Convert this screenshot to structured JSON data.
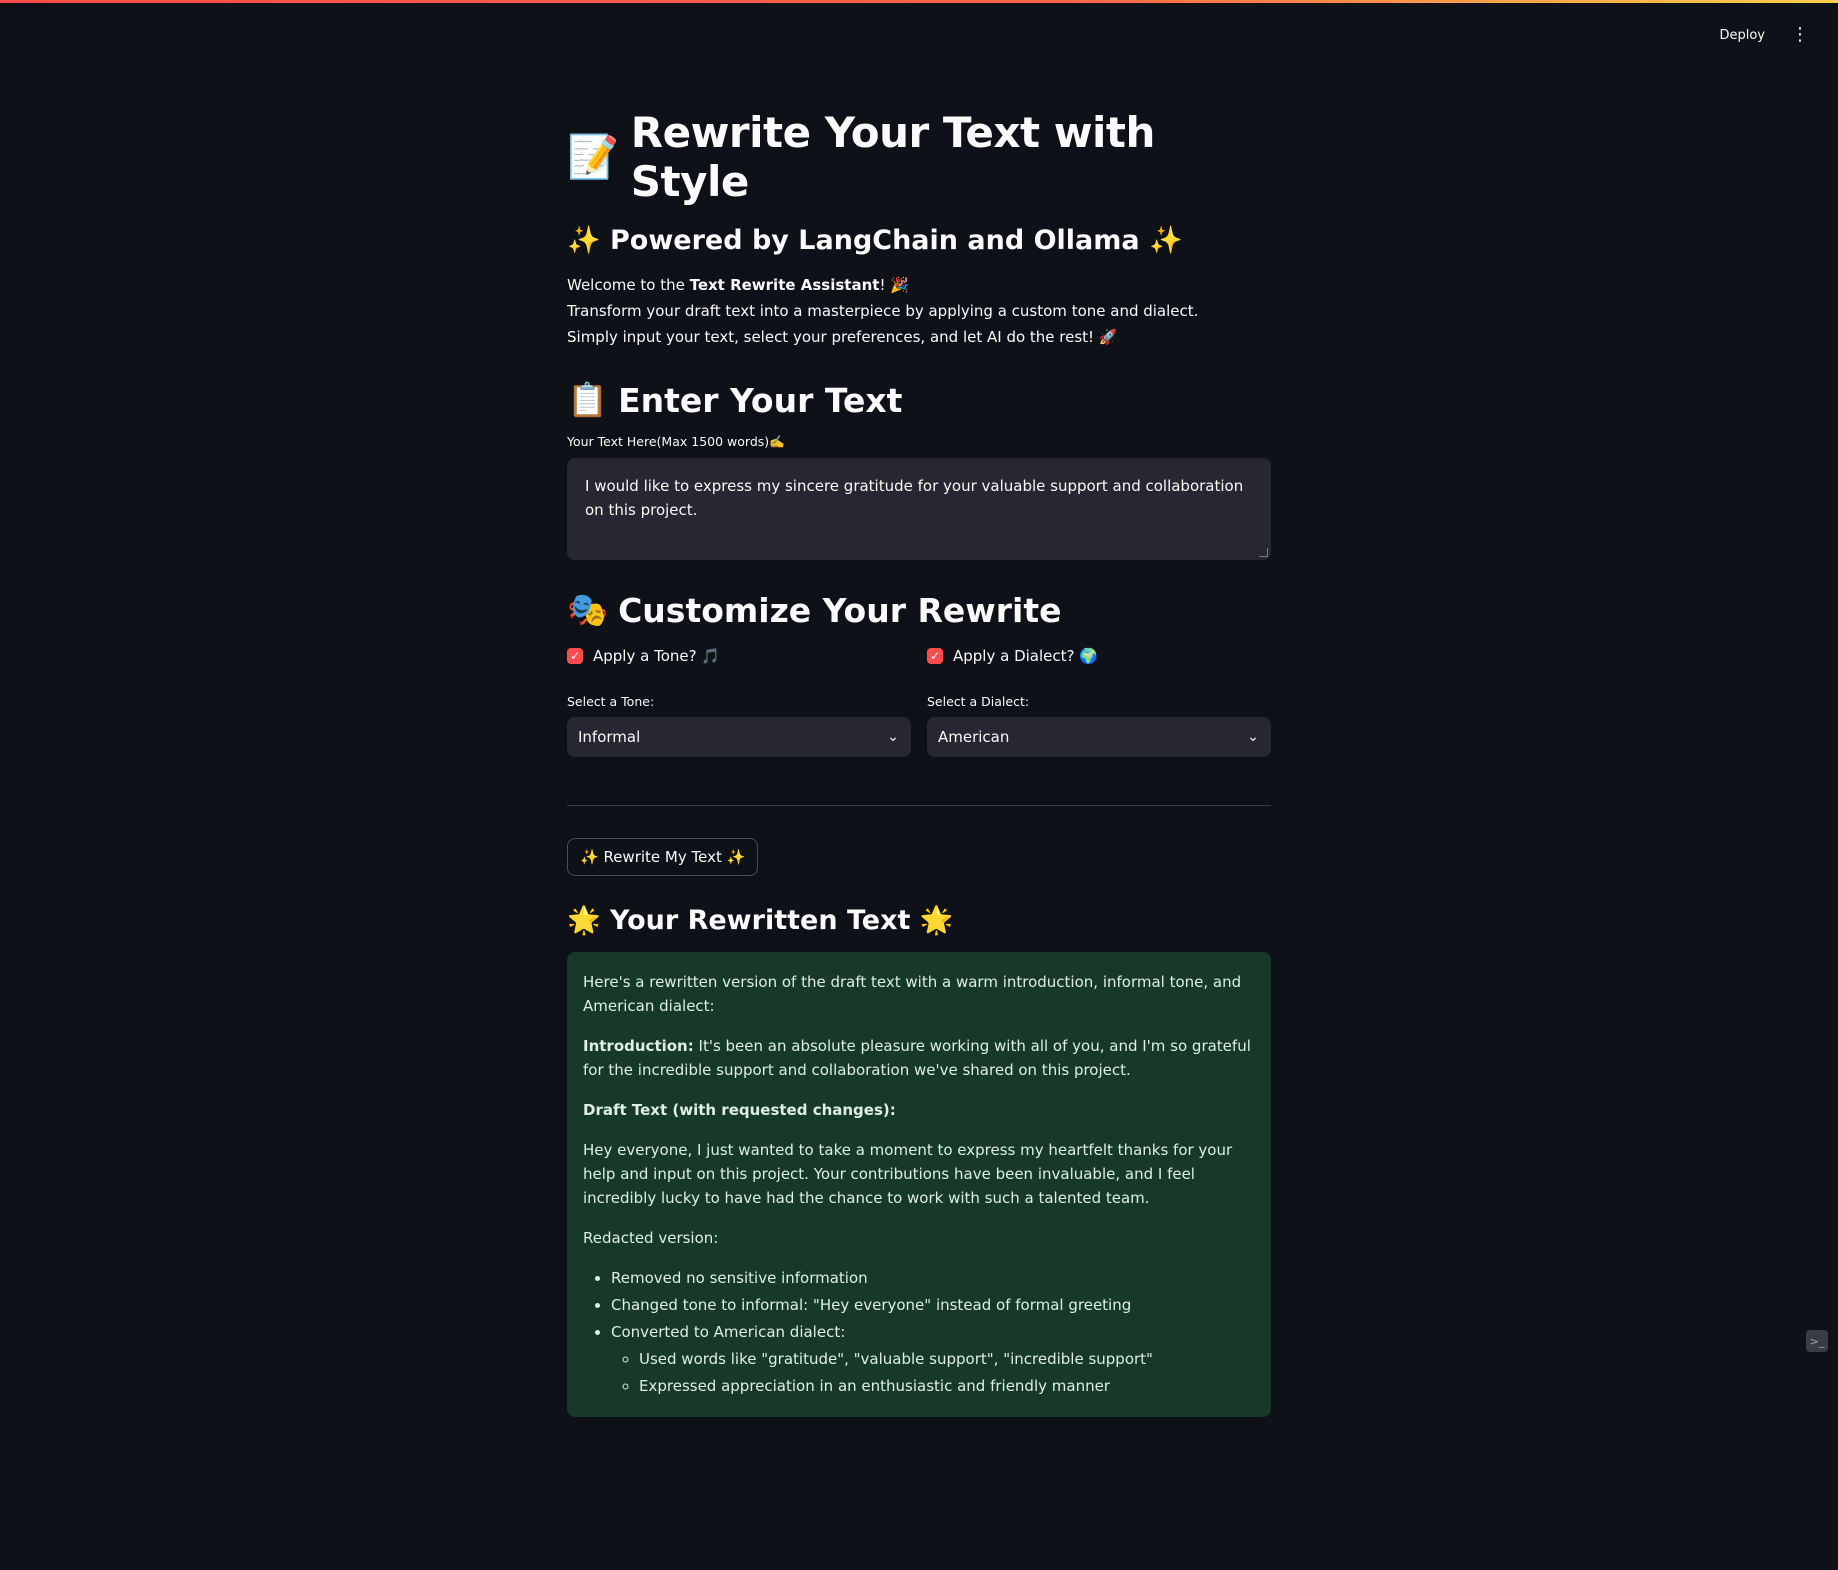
{
  "header": {
    "deploy_label": "Deploy",
    "menu_icon": "kebab-menu-icon"
  },
  "title": {
    "emoji": "📝",
    "text": "Rewrite Your Text with Style"
  },
  "subtitle": "✨ Powered by LangChain and Ollama ✨",
  "intro": {
    "line1_prefix": "Welcome to the ",
    "line1_bold": "Text Rewrite Assistant",
    "line1_suffix": "! 🎉",
    "line2": "Transform your draft text into a masterpiece by applying a custom tone and dialect.",
    "line3": "Simply input your text, select your preferences, and let AI do the rest! 🚀"
  },
  "enter_section": {
    "emoji": "📋",
    "heading": "Enter Your Text",
    "input_label": "Your Text Here(Max 1500 words)✍️",
    "input_value": "I would like to express my sincere gratitude for your valuable support and collaboration on this project."
  },
  "customize_section": {
    "emoji": "🎭",
    "heading": "Customize Your Rewrite",
    "tone_checkbox_label": "Apply a Tone? 🎵",
    "dialect_checkbox_label": "Apply a Dialect? 🌍",
    "tone_select_label": "Select a Tone:",
    "tone_selected": "Informal",
    "dialect_select_label": "Select a Dialect:",
    "dialect_selected": "American"
  },
  "rewrite_button_label": "✨ Rewrite My Text ✨",
  "result": {
    "heading": "🌟 Your Rewritten Text 🌟",
    "para1": "Here's a rewritten version of the draft text with a warm introduction, informal tone, and American dialect:",
    "intro_bold": "Introduction:",
    "intro_text": " It's been an absolute pleasure working with all of you, and I'm so grateful for the incredible support and collaboration we've shared on this project.",
    "draft_heading": "Draft Text (with requested changes):",
    "draft_text": "Hey everyone, I just wanted to take a moment to express my heartfelt thanks for your help and input on this project. Your contributions have been invaluable, and I feel incredibly lucky to have had the chance to work with such a talented team.",
    "redacted_label": "Redacted version:",
    "bullets": [
      "Removed no sensitive information",
      "Changed tone to informal: \"Hey everyone\" instead of formal greeting",
      "Converted to American dialect:"
    ],
    "sub_bullets": [
      "Used words like \"gratitude\", \"valuable support\", \"incredible support\"",
      "Expressed appreciation in an enthusiastic and friendly manner"
    ]
  }
}
